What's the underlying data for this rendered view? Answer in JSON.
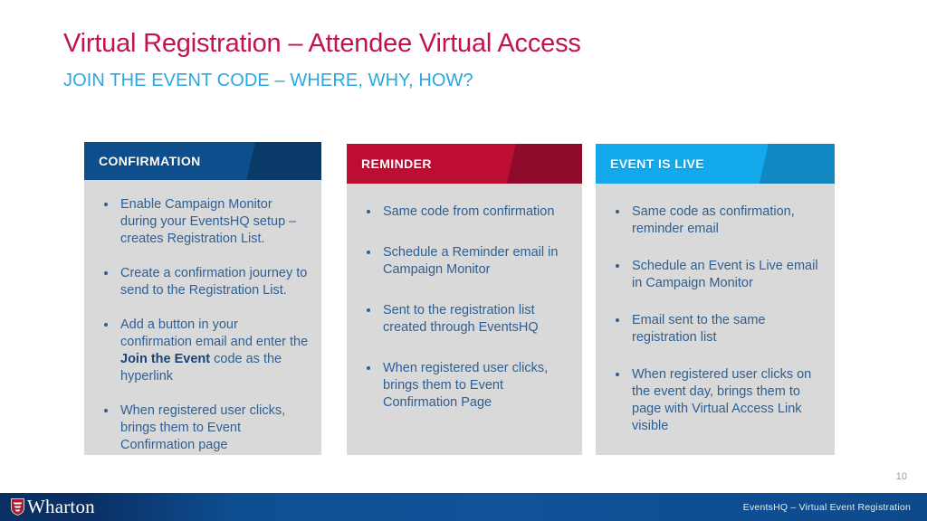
{
  "slide": {
    "title": "Virtual Registration – Attendee Virtual Access",
    "subtitle": "JOIN THE EVENT CODE – WHERE, WHY, HOW?",
    "page_number": "10",
    "title_color": "#c2134b",
    "subtitle_color": "#29a8e0"
  },
  "cards": [
    {
      "header": "CONFIRMATION",
      "header_color": "#0d4f8c",
      "bullets": [
        {
          "pre": "Enable Campaign Monitor during your EventsHQ setup – creates Registration List.",
          "strong": "",
          "post": ""
        },
        {
          "pre": "Create a confirmation journey to send to the Registration List.",
          "strong": "",
          "post": ""
        },
        {
          "pre": "Add a button in your confirmation email and enter the ",
          "strong": "Join the Event",
          "post": " code as the hyperlink"
        },
        {
          "pre": "When registered user clicks, brings them to Event Confirmation page",
          "strong": "",
          "post": ""
        }
      ]
    },
    {
      "header": "REMINDER",
      "header_color": "#bd0d33",
      "bullets": [
        {
          "pre": "Same code from confirmation",
          "strong": "",
          "post": ""
        },
        {
          "pre": "Schedule a Reminder email in Campaign Monitor",
          "strong": "",
          "post": ""
        },
        {
          "pre": "Sent to the registration list created through EventsHQ",
          "strong": "",
          "post": ""
        },
        {
          "pre": "When registered user clicks, brings them to Event Confirmation Page",
          "strong": "",
          "post": ""
        }
      ]
    },
    {
      "header": "EVENT IS LIVE",
      "header_color": "#14a9ed",
      "bullets": [
        {
          "pre": "Same code as confirmation, reminder email",
          "strong": "",
          "post": ""
        },
        {
          "pre": "Schedule an Event is Live email in Campaign Monitor",
          "strong": "",
          "post": ""
        },
        {
          "pre": "Email sent to the same registration list",
          "strong": "",
          "post": ""
        },
        {
          "pre": "When registered user clicks on the event day, brings them to page with Virtual Access Link visible",
          "strong": "",
          "post": ""
        }
      ]
    }
  ],
  "footer": {
    "logo_wordmark": "Wharton",
    "right_text": "EventsHQ – Virtual Event Registration",
    "bar_color": "#0e4f92"
  }
}
